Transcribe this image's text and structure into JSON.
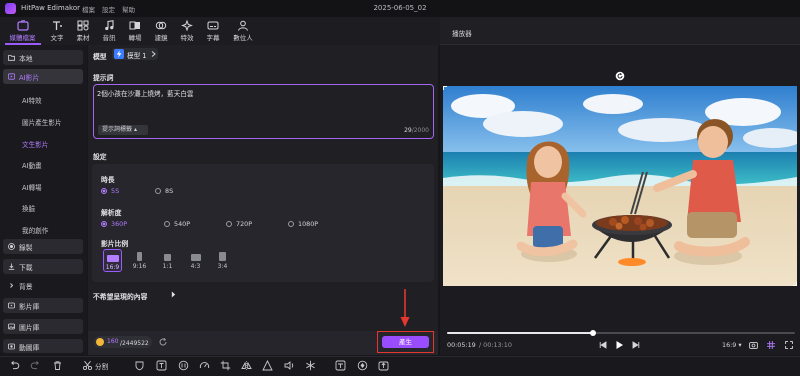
{
  "app": {
    "title": "HitPaw Edimakor",
    "menus": [
      "檔案",
      "設定",
      "幫助"
    ],
    "project_name": "2025-06-05_02"
  },
  "toolbar": {
    "tabs": [
      {
        "label": "媒體檔案",
        "icon": "media-folder-icon",
        "active": true
      },
      {
        "label": "文字",
        "icon": "text-icon",
        "active": false
      },
      {
        "label": "素材",
        "icon": "elements-icon",
        "active": false
      },
      {
        "label": "音訊",
        "icon": "music-note-icon",
        "active": false
      },
      {
        "label": "轉場",
        "icon": "transition-icon",
        "active": false
      },
      {
        "label": "濾鏡",
        "icon": "filter-icon",
        "active": false
      },
      {
        "label": "特效",
        "icon": "effects-icon",
        "active": false
      },
      {
        "label": "字幕",
        "icon": "subtitle-icon",
        "active": false
      },
      {
        "label": "數位人",
        "icon": "digital-human-icon",
        "active": false
      }
    ]
  },
  "sidebar": {
    "sections": [
      {
        "label": "本地",
        "icon": "folder-icon",
        "active": false
      },
      {
        "label": "AI影片",
        "icon": "ai-video-icon",
        "active": true
      },
      {
        "label": "錄製",
        "icon": "record-icon",
        "active": false
      },
      {
        "label": "下載",
        "icon": "download-icon",
        "active": false
      },
      {
        "label": "背景",
        "icon": "expand-icon",
        "active": false
      },
      {
        "label": "影片庫",
        "icon": "video-library-icon",
        "active": false
      },
      {
        "label": "圖片庫",
        "icon": "image-library-icon",
        "active": false
      },
      {
        "label": "動圖庫",
        "icon": "gif-library-icon",
        "active": false
      }
    ],
    "ai_sub_items": [
      {
        "label": "AI特效",
        "active": false
      },
      {
        "label": "圖片產生影片",
        "active": false
      },
      {
        "label": "文生影片",
        "active": true
      },
      {
        "label": "AI動畫",
        "active": false
      },
      {
        "label": "AI轉場",
        "active": false
      },
      {
        "label": "換臉",
        "active": false
      },
      {
        "label": "我的創作",
        "active": false
      }
    ]
  },
  "main": {
    "model_label": "模型",
    "model_value": "模型 1",
    "prompt_label": "提示詞",
    "prompt_text": "2個小孩在沙灘上燒烤，藍天白雲",
    "prompt_tag_button": "提示詞標籤",
    "prompt_count": "29",
    "prompt_max": "/2000",
    "settings_label": "設定",
    "duration_label": "時長",
    "duration_options": [
      {
        "label": "5S",
        "selected": true
      },
      {
        "label": "8S",
        "selected": false
      }
    ],
    "resolution_label": "解析度",
    "resolution_options": [
      {
        "label": "360P",
        "selected": true
      },
      {
        "label": "540P",
        "selected": false
      },
      {
        "label": "720P",
        "selected": false
      },
      {
        "label": "1080P",
        "selected": false
      }
    ],
    "ratio_label": "影片比例",
    "ratio_options": [
      {
        "label": "16:9",
        "selected": true
      },
      {
        "label": "9:16",
        "selected": false
      },
      {
        "label": "1:1",
        "selected": false
      },
      {
        "label": "4:3",
        "selected": false
      },
      {
        "label": "3:4",
        "selected": false
      }
    ],
    "negative_label": "不希望呈現的內容",
    "credits_used": "160",
    "credits_total": "/2449522",
    "generate_label": "產生"
  },
  "player": {
    "title": "播放器",
    "current_time": "00:05:19",
    "total_time": "/ 00:13:10",
    "progress": 0.42,
    "aspect": "16:9",
    "colors": {
      "sky": "#3b8fd9",
      "sea": "#1fa3b8",
      "sand": "#e9d7b8",
      "accent": "#9a4dff",
      "highlight": "#e5362f"
    }
  },
  "bottom_toolbar": {
    "split_label": "分割",
    "icons": [
      "undo-icon",
      "redo-icon",
      "delete-icon",
      "split-icon",
      "mask-icon",
      "text-tool-icon",
      "freeze-icon",
      "speed-icon",
      "crop-icon",
      "mirror-icon",
      "color-icon",
      "audio-icon",
      "ai-icon",
      "snowflake-icon",
      "caption-icon",
      "keyframe-icon",
      "face-icon",
      "export-frame-icon"
    ]
  }
}
